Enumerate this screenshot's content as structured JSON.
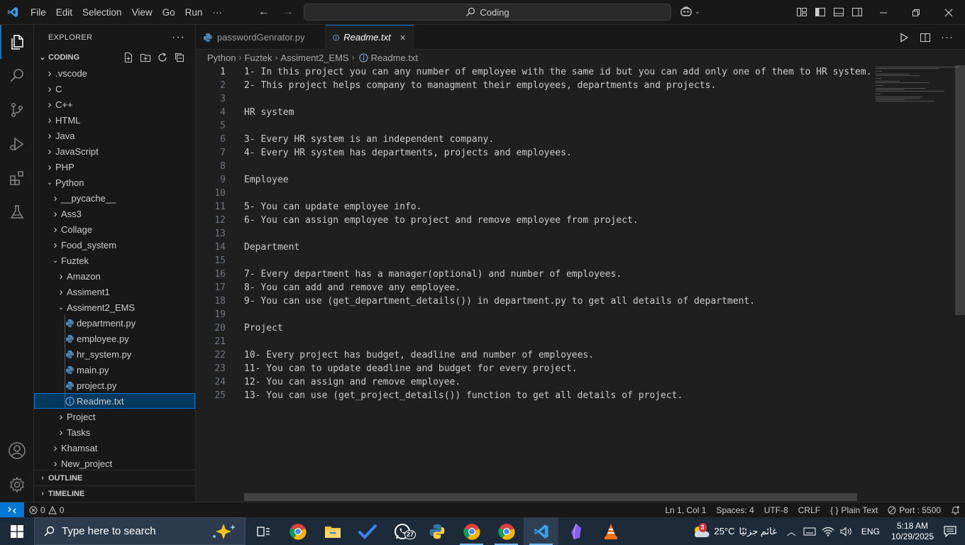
{
  "titlebar": {
    "menu": [
      "File",
      "Edit",
      "Selection",
      "View",
      "Go",
      "Run",
      "···"
    ],
    "search_text": "Coding"
  },
  "sidebar": {
    "title": "EXPLORER",
    "dots": "···",
    "workspace": "CODING",
    "tree": [
      {
        "label": ".vscode",
        "type": "folder",
        "depth": 0,
        "open": false
      },
      {
        "label": "C",
        "type": "folder",
        "depth": 0,
        "open": false
      },
      {
        "label": "C++",
        "type": "folder",
        "depth": 0,
        "open": false
      },
      {
        "label": "HTML",
        "type": "folder",
        "depth": 0,
        "open": false
      },
      {
        "label": "Java",
        "type": "folder",
        "depth": 0,
        "open": false
      },
      {
        "label": "JavaScript",
        "type": "folder",
        "depth": 0,
        "open": false
      },
      {
        "label": "PHP",
        "type": "folder",
        "depth": 0,
        "open": false
      },
      {
        "label": "Python",
        "type": "folder",
        "depth": 0,
        "open": true
      },
      {
        "label": "__pycache__",
        "type": "folder",
        "depth": 1,
        "open": false
      },
      {
        "label": "Ass3",
        "type": "folder",
        "depth": 1,
        "open": false
      },
      {
        "label": "Collage",
        "type": "folder",
        "depth": 1,
        "open": false
      },
      {
        "label": "Food_system",
        "type": "folder",
        "depth": 1,
        "open": false
      },
      {
        "label": "Fuztek",
        "type": "folder",
        "depth": 1,
        "open": true
      },
      {
        "label": "Amazon",
        "type": "folder",
        "depth": 2,
        "open": false
      },
      {
        "label": "Assiment1",
        "type": "folder",
        "depth": 2,
        "open": false
      },
      {
        "label": "Assiment2_EMS",
        "type": "folder",
        "depth": 2,
        "open": true
      },
      {
        "label": "department.py",
        "type": "py",
        "depth": 3
      },
      {
        "label": "employee.py",
        "type": "py",
        "depth": 3
      },
      {
        "label": "hr_system.py",
        "type": "py",
        "depth": 3
      },
      {
        "label": "main.py",
        "type": "py",
        "depth": 3
      },
      {
        "label": "project.py",
        "type": "py",
        "depth": 3
      },
      {
        "label": "Readme.txt",
        "type": "txt",
        "depth": 3,
        "selected": true
      },
      {
        "label": "Project",
        "type": "folder",
        "depth": 2,
        "open": false
      },
      {
        "label": "Tasks",
        "type": "folder",
        "depth": 2,
        "open": false
      },
      {
        "label": "Khamsat",
        "type": "folder",
        "depth": 1,
        "open": false
      },
      {
        "label": "New_project",
        "type": "folder",
        "depth": 1,
        "open": false
      }
    ],
    "outline": "OUTLINE",
    "timeline": "TIMELINE"
  },
  "tabs": [
    {
      "label": "passwordGenrator.py",
      "icon": "python-file-icon",
      "active": false
    },
    {
      "label": "Readme.txt",
      "icon": "info-icon",
      "active": true
    }
  ],
  "breadcrumbs": [
    "Python",
    "Fuztek",
    "Assiment2_EMS",
    "Readme.txt"
  ],
  "editor": {
    "current_line": 1,
    "lines": [
      "1- In this project you can any number of employee with the same id but you can add only one of them to HR system.",
      "2- This project helps company to managment their employees, departments and projects.",
      "",
      "HR system",
      "",
      "3- Every HR system is an independent company.",
      "4- Every HR system has departments, projects and employees.",
      "",
      "Employee",
      "",
      "5- You can update employee info.",
      "6- You can assign employee to project and remove employee from project.",
      "",
      "Department",
      "",
      "7- Every department has a manager(optional) and number of employees.",
      "8- You can add and remove any employee.",
      "9- You can use (get_department_details()) in department.py to get all details of department.",
      "",
      "Project",
      "",
      "10- Every project has budget, deadline and number of employees.",
      "11- You can to update deadline and budget for every project.",
      "12- You can assign and remove employee.",
      "13- You can use (get_project_details()) function to get all details of project."
    ]
  },
  "statusbar": {
    "errors": "0",
    "warnings": "0",
    "position": "Ln 1, Col 1",
    "spaces": "Spaces: 4",
    "encoding": "UTF-8",
    "eol": "CRLF",
    "language": "Plain Text",
    "port": "Port : 5500"
  },
  "taskbar": {
    "search_placeholder": "Type here to search",
    "weather_temp": "25°C",
    "weather_desc": "غائم جزئيًا",
    "language": "ENG",
    "time": "5:18 AM",
    "date": "10/29/2025",
    "whatsapp_badge": "27",
    "weather_badge": "3"
  },
  "colors": {
    "accent": "#0078d4",
    "editor_bg": "#1f1f1f",
    "sidebar_bg": "#181818",
    "selection": "#04395e",
    "python_icon": "#4b8bbe"
  }
}
